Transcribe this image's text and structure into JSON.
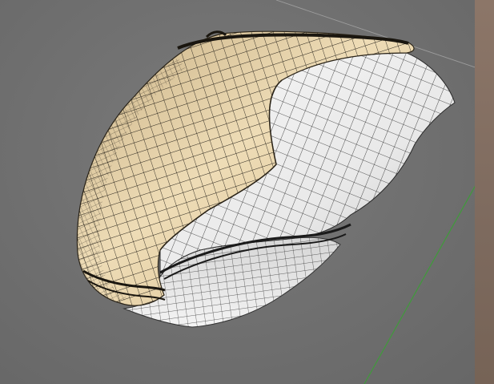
{
  "viewport": {
    "background_color": "#6f6f6f",
    "side_panel_color": "#83705f",
    "grid_axis_color": "#3f9b3a",
    "grid_line_color": "#a8a8a8"
  },
  "model": {
    "object": "mouse-shell-mesh",
    "display": "wireframe-on-shaded",
    "shell_color": "#e9d6b0",
    "shell_shadow_color": "#b89c6c",
    "side_color": "#f2f2f2",
    "side_shadow_color": "#b9b9b9",
    "wire_color": "#1e1a14"
  }
}
